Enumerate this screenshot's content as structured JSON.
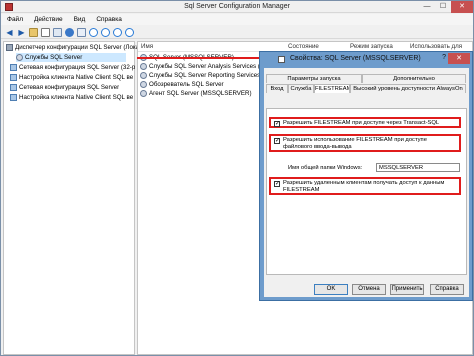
{
  "window": {
    "title": "Sql Server Configuration Manager",
    "buttons": [
      "—",
      "☐",
      "✕"
    ]
  },
  "menu": [
    "Файл",
    "Действие",
    "Вид",
    "Справка"
  ],
  "tree": {
    "items": [
      {
        "label": "Диспетчер конфигурации SQL Server (Лока",
        "icon": "server-icon"
      },
      {
        "label": "Службы SQL Server",
        "icon": "services-icon"
      },
      {
        "label": "Сетевая конфигурация SQL Server (32-р",
        "icon": "network-icon"
      },
      {
        "label": "Настройка клиента Native Client SQL ве",
        "icon": "network-icon"
      },
      {
        "label": "Сетевая конфигурация SQL Server",
        "icon": "network-icon"
      },
      {
        "label": "Настройка клиента Native Client SQL ве",
        "icon": "network-icon"
      }
    ]
  },
  "list": {
    "columns": [
      "Имя",
      "Состояние",
      "Режим запуска",
      "Использовать для"
    ],
    "rows": [
      "SQL Server (MSSQLSERVER)",
      "Службы SQL Server Analysis Services (MSS",
      "Службы SQL Server Reporting Services (MS",
      "Обозреватель SQL Server",
      "Агент SQL Server (MSSQLSERVER)"
    ]
  },
  "dialog": {
    "title": "Свойства: SQL Server (MSSQLSERVER)",
    "help": "?",
    "close": "✕",
    "tabs_top": [
      "Параметры запуска",
      "Дополнительно"
    ],
    "tabs_bottom": [
      "Вход",
      "Служба",
      "FILESTREAM",
      "Высокий уровень доступности AlwaysOn"
    ],
    "active_tab": "FILESTREAM",
    "options": {
      "opt1": "Разрешить FILESTREAM при доступе через Transact-SQL",
      "opt2": "Разрешить использование FILESTREAM при доступе файлового ввода-вывода",
      "opt3": "Разрешить удаленным клиентам получать доступ к данным FILESTREAM"
    },
    "share_label": "Имя общей папки Windows:",
    "share_value": "MSSQLSERVER",
    "buttons": {
      "ok": "OK",
      "cancel": "Отмена",
      "apply": "Применить",
      "help": "Справка"
    }
  },
  "colors": {
    "highlight": "#e01c1c",
    "dialog_frame": "#6e9ccc",
    "selection": "#cde8ff"
  }
}
